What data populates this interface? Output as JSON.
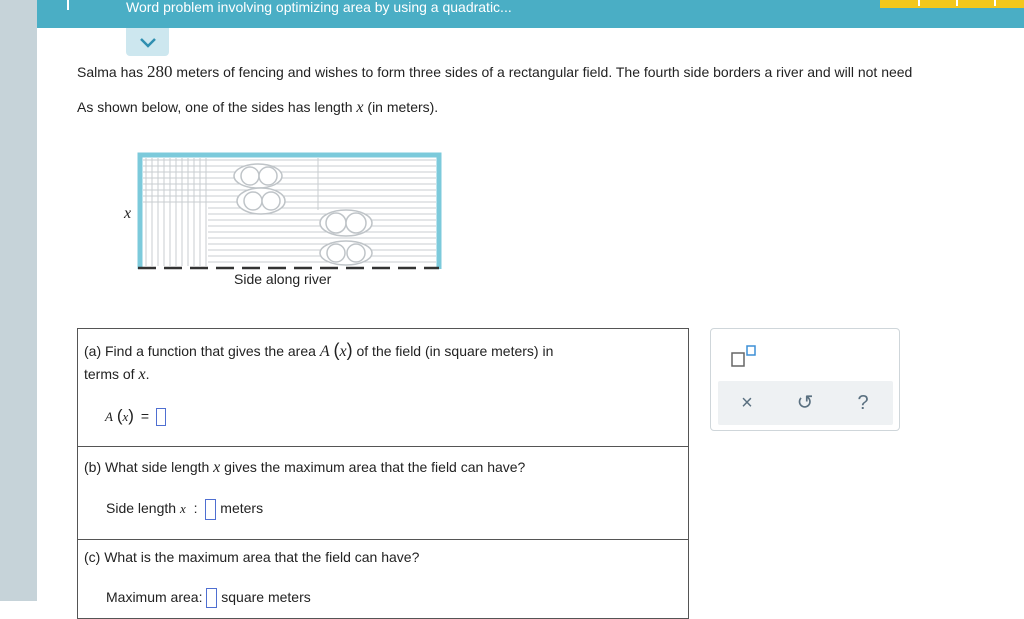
{
  "header": {
    "title": "Word problem involving optimizing area by using a quadratic..."
  },
  "problem": {
    "line1_before": "Salma has ",
    "fence_length": "280",
    "line1_after": " meters of fencing and wishes to form three sides of a rectangular field. The fourth side borders a river and will not need",
    "line2_before": "As shown below, one of the sides has length ",
    "variable": "x",
    "line2_after": " (in meters)."
  },
  "diagram": {
    "side_label": "x",
    "river_label": "Side along river"
  },
  "part_a": {
    "prompt_before": "(a) Find a function that gives the area ",
    "func": "A",
    "arg": "x",
    "prompt_after": " of the field (in square meters) in",
    "prompt_line2_before": "terms of ",
    "prompt_line2_var": "x",
    "prompt_line2_after": ".",
    "lhs": "A",
    "lhs_arg": "x",
    "equals": "=",
    "answer": ""
  },
  "part_b": {
    "prompt_before": "(b) What side length ",
    "var": "x",
    "prompt_after": " gives the maximum area that the field can have?",
    "label": "Side length ",
    "label_var": "x",
    "colon": ":",
    "unit": "meters",
    "answer": ""
  },
  "part_c": {
    "prompt": "(c) What is the maximum area that the field can have?",
    "label": "Maximum area:",
    "unit": "square meters",
    "answer": ""
  },
  "tools": {
    "clear": "×",
    "undo": "↺",
    "help": "?"
  },
  "colors": {
    "header": "#4aaec5",
    "fence": "#7ccadb",
    "progress": "#f4c71c",
    "answer_border": "#4f6fd1"
  }
}
